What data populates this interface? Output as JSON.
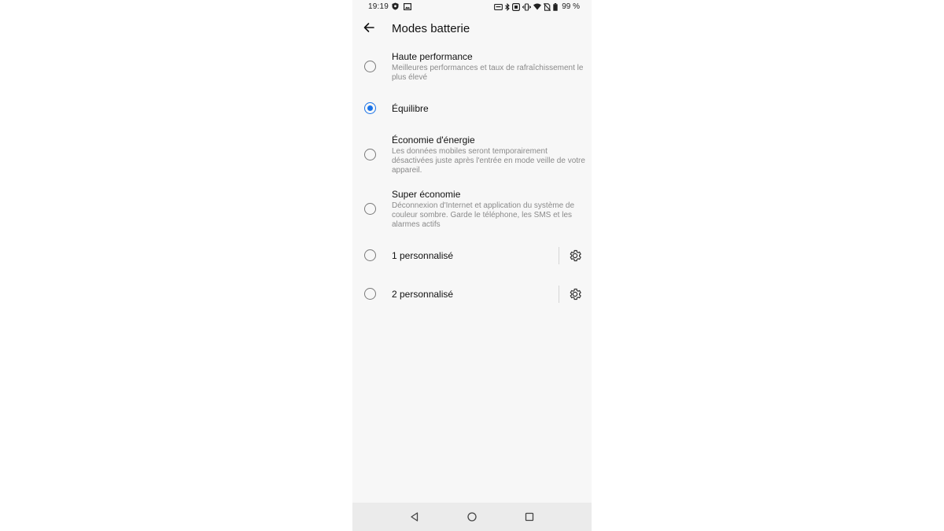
{
  "status_bar": {
    "time": "19:19",
    "battery": "99 %",
    "left_icons": [
      "shield-icon",
      "image-icon"
    ],
    "right_icons": [
      "nfc-icon",
      "bluetooth-icon",
      "screenshot-icon",
      "vibrate-icon",
      "wifi-icon",
      "no-sim-icon",
      "battery-icon"
    ]
  },
  "header": {
    "title": "Modes batterie"
  },
  "options": [
    {
      "title": "Haute performance",
      "description": "Meilleures performances et taux de rafraîchissement le plus élevé",
      "checked": false
    },
    {
      "title": "Équilibre",
      "description": "",
      "checked": true
    },
    {
      "title": "Économie d'énergie",
      "description": "Les données mobiles seront temporairement désactivées juste après l'entrée en mode veille de votre appareil.",
      "checked": false
    },
    {
      "title": "Super économie",
      "description": "Déconnexion d'Internet et application du système de couleur sombre. Garde le téléphone, les SMS et les alarmes actifs",
      "checked": false
    },
    {
      "title": "1 personnalisé",
      "description": "",
      "checked": false,
      "has_settings": true
    },
    {
      "title": "2 personnalisé",
      "description": "",
      "checked": false,
      "has_settings": true
    }
  ],
  "nav_bar": {
    "icons": [
      "back-triangle-icon",
      "home-circle-icon",
      "recents-square-icon"
    ]
  },
  "colors": {
    "accent": "#1a73e8",
    "background": "#f7f7f7",
    "nav_background": "#ebebeb",
    "secondary_text": "#8a8a8a"
  }
}
